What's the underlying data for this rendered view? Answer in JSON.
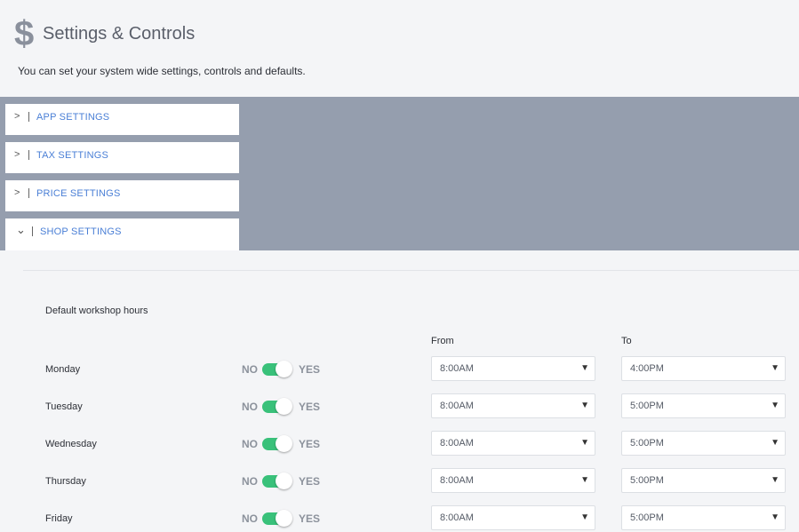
{
  "header": {
    "icon": "dollar-icon",
    "title": "Settings & Controls",
    "subtitle": "You can set your system wide settings, controls and defaults."
  },
  "accordion": [
    {
      "label": "APP SETTINGS",
      "expanded": false,
      "chevron": ">"
    },
    {
      "label": "TAX SETTINGS",
      "expanded": false,
      "chevron": ">"
    },
    {
      "label": "PRICE SETTINGS",
      "expanded": false,
      "chevron": ">"
    },
    {
      "label": "SHOP SETTINGS",
      "expanded": true,
      "chevron": "⌄"
    }
  ],
  "shop": {
    "section_title": "Default workshop hours",
    "from_label": "From",
    "to_label": "To",
    "no_label": "NO",
    "yes_label": "YES",
    "arrow": "▼",
    "days": [
      {
        "name": "Monday",
        "enabled": true,
        "from": "8:00AM",
        "to": "4:00PM"
      },
      {
        "name": "Tuesday",
        "enabled": true,
        "from": "8:00AM",
        "to": "5:00PM"
      },
      {
        "name": "Wednesday",
        "enabled": true,
        "from": "8:00AM",
        "to": "5:00PM"
      },
      {
        "name": "Thursday",
        "enabled": true,
        "from": "8:00AM",
        "to": "5:00PM"
      },
      {
        "name": "Friday",
        "enabled": true,
        "from": "8:00AM",
        "to": "5:00PM"
      }
    ]
  },
  "colors": {
    "accent": "#4a7fd6",
    "toggle_on": "#39c17a",
    "band": "#959eae"
  }
}
